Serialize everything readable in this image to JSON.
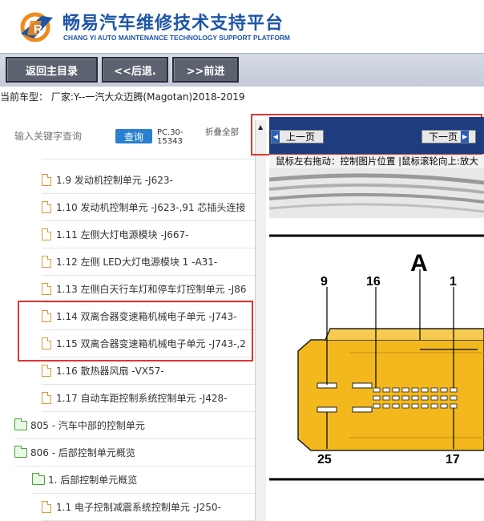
{
  "header": {
    "title": "畅易汽车维修技术支持平台",
    "subtitle": "CHANG YI AUTO MAINTENANCE TECHNOLOGY SUPPORT PLATFORM"
  },
  "toolbar": {
    "main_menu": "返回主目录",
    "back": "<<后退.",
    "forward": ">>前进"
  },
  "model_line": "当前车型： 厂家:Y--一汽大众迈腾(Magotan)2018-2019",
  "search": {
    "placeholder": "输入关键字查询",
    "button": "查询",
    "pc_label": "PC.30-15343",
    "collapse": "折叠全部"
  },
  "tree": [
    {
      "label": "1.9 发动机控制单元 -J623-",
      "type": "file"
    },
    {
      "label": "1.10 发动机控制单元 -J623-,91 芯插头连接",
      "type": "file"
    },
    {
      "label": "1.11 左侧大灯电源模块 -J667-",
      "type": "file"
    },
    {
      "label": "1.12 左侧 LED大灯电源模块 1 -A31-",
      "type": "file"
    },
    {
      "label": "1.13 左侧白天行车灯和停车灯控制单元 -J86",
      "type": "file"
    },
    {
      "label": "1.14 双离合器变速箱机械电子单元 -J743-",
      "type": "file"
    },
    {
      "label": "1.15 双离合器变速箱机械电子单元 -J743-,2",
      "type": "file"
    },
    {
      "label": "1.16 散热器风扇 -VX57-",
      "type": "file"
    },
    {
      "label": "1.17 自动车距控制系统控制单元 -J428-",
      "type": "file"
    },
    {
      "label": "805 - 汽车中部的控制单元",
      "type": "folder"
    },
    {
      "label": "806 - 后部控制单元概览",
      "type": "folder"
    },
    {
      "label": "1. 后部控制单元概览",
      "type": "folder"
    },
    {
      "label": "1.1 电子控制减震系统控制单元 -J250-",
      "type": "file"
    }
  ],
  "viewer": {
    "prev": "上一页",
    "next": "下一页",
    "hint": "鼠标左右拖动：控制图片位置 |鼠标滚轮向上:放大",
    "diagram_labels": {
      "connector": "A",
      "pin_9": "9",
      "pin_16": "16",
      "pin_1": "1",
      "pin_25": "25",
      "pin_17": "17"
    }
  },
  "colors": {
    "brand_blue": "#1d55a8",
    "viewer_bar": "#1e3c80",
    "connector": "#f2b81e",
    "highlight": "#e03535"
  }
}
